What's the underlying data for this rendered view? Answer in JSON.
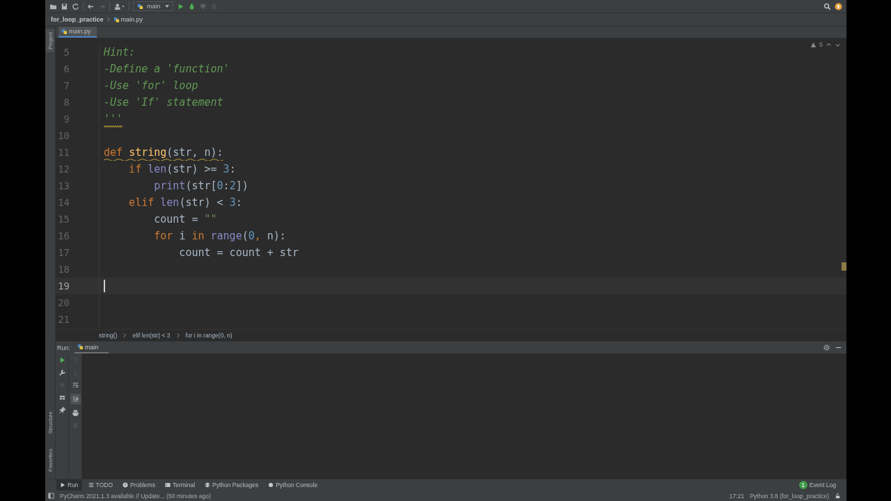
{
  "toolbar": {
    "run_config": "main"
  },
  "nav": {
    "project": "for_loop_practice",
    "file": "main.py"
  },
  "editor_tabs": [
    {
      "label": "main.py",
      "selected": true
    }
  ],
  "side_tabs": {
    "top": "Project",
    "bottom": [
      "Structure",
      "Favorites"
    ]
  },
  "inspections": {
    "warnings": "5"
  },
  "code_lines": [
    {
      "number": "5",
      "current": false,
      "warning": false,
      "tokens": [
        {
          "kind": "comment",
          "text": "Hint:"
        }
      ]
    },
    {
      "number": "6",
      "current": false,
      "warning": false,
      "tokens": [
        {
          "kind": "comment",
          "text": "-Define a 'function'"
        }
      ]
    },
    {
      "number": "7",
      "current": false,
      "warning": false,
      "tokens": [
        {
          "kind": "comment",
          "text": "-Use 'for' loop"
        }
      ]
    },
    {
      "number": "8",
      "current": false,
      "warning": false,
      "tokens": [
        {
          "kind": "comment",
          "text": "-Use 'If' statement"
        }
      ]
    },
    {
      "number": "9",
      "current": false,
      "warning": true,
      "tokens": [
        {
          "kind": "comment",
          "text": "'''"
        }
      ]
    },
    {
      "number": "10",
      "current": false
    },
    {
      "number": "11",
      "current": false,
      "warning": true,
      "tokens": [
        {
          "kind": "keyword",
          "text": "def "
        },
        {
          "kind": "function",
          "text": "string"
        },
        {
          "kind": "plain",
          "text": "(str, n):"
        }
      ]
    },
    {
      "number": "12",
      "current": false,
      "warning": false,
      "tokens": [
        {
          "kind": "keyword",
          "text": "    if "
        },
        {
          "kind": "builtin",
          "text": "len"
        },
        {
          "kind": "plain",
          "text": "(str) >= "
        },
        {
          "kind": "number",
          "text": "3"
        },
        {
          "kind": "plain",
          "text": ":"
        }
      ]
    },
    {
      "number": "13",
      "current": false,
      "warning": false,
      "tokens": [
        {
          "kind": "builtin",
          "text": "        print"
        },
        {
          "kind": "plain",
          "text": "(str["
        },
        {
          "kind": "number",
          "text": "0"
        },
        {
          "kind": "plain",
          "text": ":"
        },
        {
          "kind": "number",
          "text": "2"
        },
        {
          "kind": "plain",
          "text": "])"
        }
      ]
    },
    {
      "number": "14",
      "current": false,
      "warning": false,
      "tokens": [
        {
          "kind": "keyword",
          "text": "    elif "
        },
        {
          "kind": "builtin",
          "text": "len"
        },
        {
          "kind": "plain",
          "text": "(str) < "
        },
        {
          "kind": "number",
          "text": "3"
        },
        {
          "kind": "plain",
          "text": ":"
        }
      ]
    },
    {
      "number": "15",
      "current": false,
      "warning": false,
      "tokens": [
        {
          "kind": "plain",
          "text": "        count = "
        },
        {
          "kind": "string",
          "text": "\"\""
        }
      ]
    },
    {
      "number": "16",
      "current": false,
      "warning": false,
      "tokens": [
        {
          "kind": "keyword",
          "text": "        for "
        },
        {
          "kind": "plain",
          "text": "i "
        },
        {
          "kind": "keyword",
          "text": "in "
        },
        {
          "kind": "builtin",
          "text": "range"
        },
        {
          "kind": "plain",
          "text": "("
        },
        {
          "kind": "number",
          "text": "0"
        },
        {
          "kind": "keyword",
          "text": ", "
        },
        {
          "kind": "plain",
          "text": "n):"
        }
      ]
    },
    {
      "number": "17",
      "current": false,
      "warning": false,
      "tokens": [
        {
          "kind": "plain",
          "text": "            count = count + str"
        }
      ]
    },
    {
      "number": "18",
      "current": false
    },
    {
      "number": "19",
      "current": true
    },
    {
      "number": "20",
      "current": false
    },
    {
      "number": "21",
      "current": false
    }
  ],
  "breadcrumbs": [
    "string()",
    "elif len(str) < 3",
    "for i in range(0, n)"
  ],
  "run_panel": {
    "label": "Run:",
    "tabs": [
      {
        "label": "main",
        "selected": true
      }
    ]
  },
  "tool_tabs": [
    {
      "label": "Run",
      "kind": "run",
      "selected": true
    },
    {
      "label": "TODO",
      "kind": "list",
      "selected": false
    },
    {
      "label": "Problems",
      "kind": "problems",
      "selected": false
    },
    {
      "label": "Terminal",
      "kind": "terminal",
      "selected": false
    },
    {
      "label": "Python Packages",
      "kind": "packages",
      "selected": false
    },
    {
      "label": "Python Console",
      "kind": "console",
      "selected": false
    }
  ],
  "event_log": {
    "count": "1",
    "label": "Event Log"
  },
  "status_bar": {
    "message": "PyCharm 2021.1.3 available // Update... (50 minutes ago)",
    "position": "17:21",
    "interpreter": "Python 3.8 (for_loop_practice)"
  }
}
